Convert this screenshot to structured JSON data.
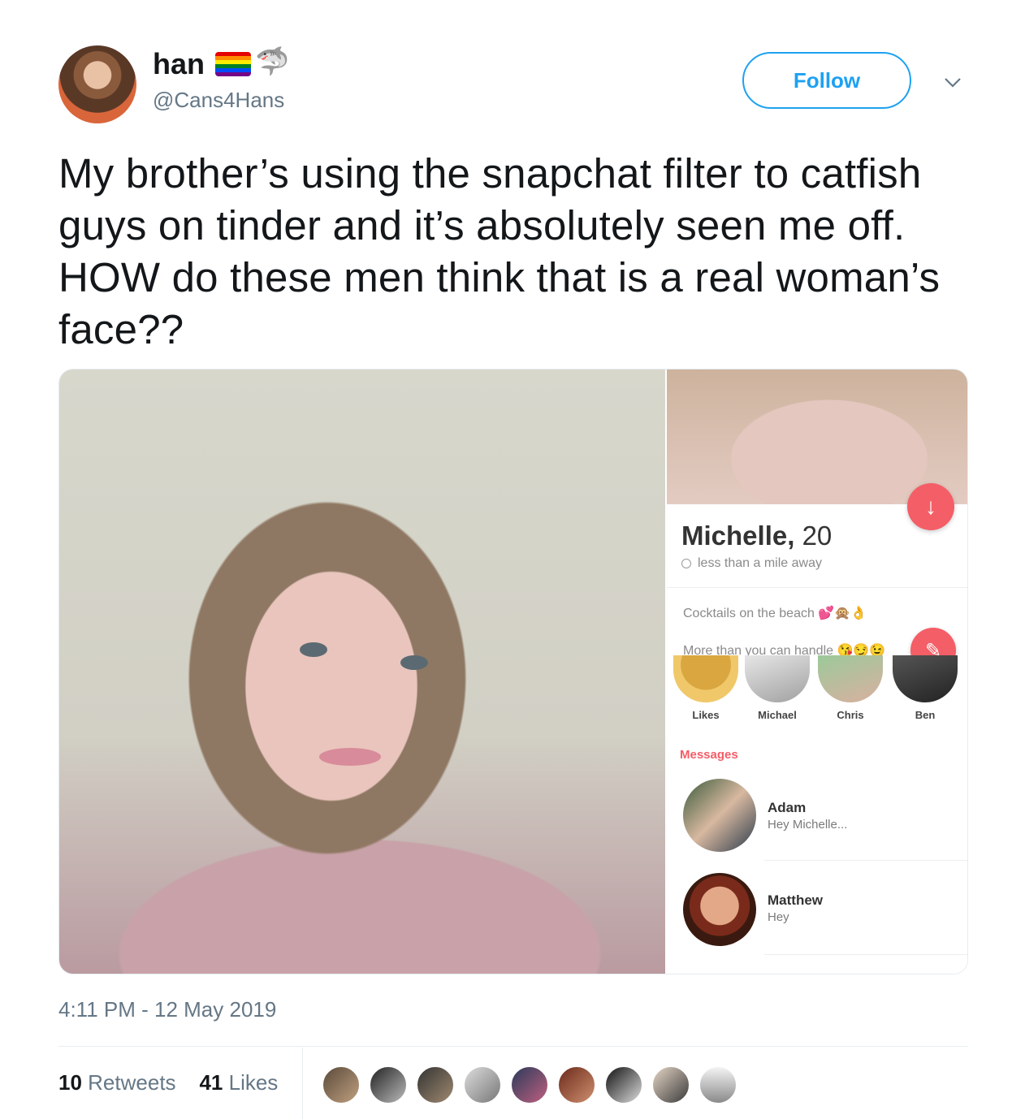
{
  "author": {
    "name": "han",
    "emoji_flag": "rainbow-flag-icon",
    "emoji_shark": "🦈",
    "handle": "@Cans4Hans"
  },
  "follow_label": "Follow",
  "tweet": {
    "text": "My brother’s using the snapchat filter to catfish guys on tinder and it’s absolutely seen me off. HOW do these men think that is a real woman’s face??"
  },
  "tinder": {
    "name": "Michelle,",
    "age": "20",
    "distance": "less than a mile away",
    "bio_line1": "Cocktails on the beach 💕🙊👌",
    "bio_line2": "More than you can handle 😘😏😉",
    "matches": [
      "Likes",
      "Michael",
      "Chris",
      "Ben"
    ],
    "messages_header": "Messages",
    "messages": [
      {
        "name": "Adam",
        "preview": "Hey Michelle..."
      },
      {
        "name": "Matthew",
        "preview": "Hey"
      }
    ]
  },
  "timestamp": "4:11 PM - 12 May 2019",
  "stats": {
    "retweets_count": "10",
    "retweets_label": "Retweets",
    "likes_count": "41",
    "likes_label": "Likes"
  },
  "colors": {
    "link_blue": "#1da1f2",
    "tinder_red": "#f45e66",
    "secondary_text": "#657786"
  }
}
